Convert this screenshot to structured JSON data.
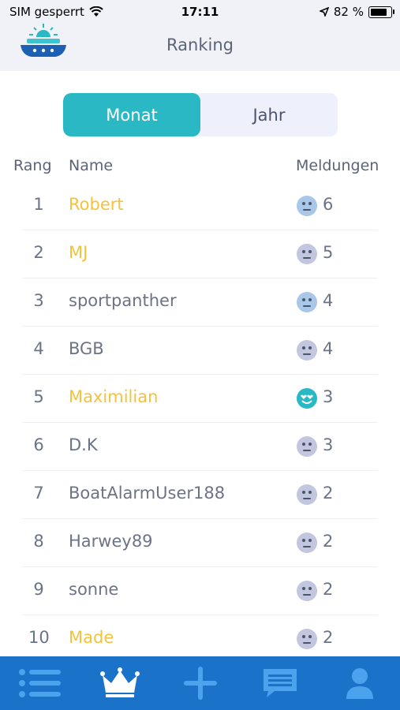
{
  "status_bar": {
    "carrier": "SIM gesperrt",
    "time": "17:11",
    "battery": "82 %"
  },
  "nav": {
    "title": "Ranking",
    "logo_icon": "boat-alarm-logo-icon"
  },
  "segments": [
    {
      "label": "Monat",
      "active": true
    },
    {
      "label": "Jahr",
      "active": false
    }
  ],
  "table": {
    "headers": {
      "rank": "Rang",
      "name": "Name",
      "reports": "Meldungen"
    },
    "rows": [
      {
        "rank": "1",
        "name": "Robert",
        "count": "6",
        "highlight": true,
        "face": "neutral-blue"
      },
      {
        "rank": "2",
        "name": "MJ",
        "count": "5",
        "highlight": true,
        "face": "neutral-lavender"
      },
      {
        "rank": "3",
        "name": "sportpanther",
        "count": "4",
        "highlight": false,
        "face": "neutral-blue"
      },
      {
        "rank": "4",
        "name": "BGB",
        "count": "4",
        "highlight": false,
        "face": "neutral-lavender"
      },
      {
        "rank": "5",
        "name": "Maximilian",
        "count": "3",
        "highlight": true,
        "face": "heart-eyes-teal"
      },
      {
        "rank": "6",
        "name": "D.K",
        "count": "3",
        "highlight": false,
        "face": "neutral-lavender"
      },
      {
        "rank": "7",
        "name": "BoatAlarmUser188",
        "count": "2",
        "highlight": false,
        "face": "neutral-lavender"
      },
      {
        "rank": "8",
        "name": "Harwey89",
        "count": "2",
        "highlight": false,
        "face": "neutral-lavender"
      },
      {
        "rank": "9",
        "name": "sonne",
        "count": "2",
        "highlight": false,
        "face": "neutral-lavender"
      },
      {
        "rank": "10",
        "name": "Made",
        "count": "2",
        "highlight": true,
        "face": "neutral-lavender"
      }
    ]
  },
  "tab_bar": {
    "items": [
      {
        "icon": "list-icon"
      },
      {
        "icon": "crown-icon",
        "active": true
      },
      {
        "icon": "plus-icon"
      },
      {
        "icon": "chat-icon"
      },
      {
        "icon": "profile-icon"
      }
    ]
  },
  "colors": {
    "accent": "#2ab9c4",
    "highlight_name": "#f5c23b",
    "tab_bar": "#1a73c9"
  }
}
